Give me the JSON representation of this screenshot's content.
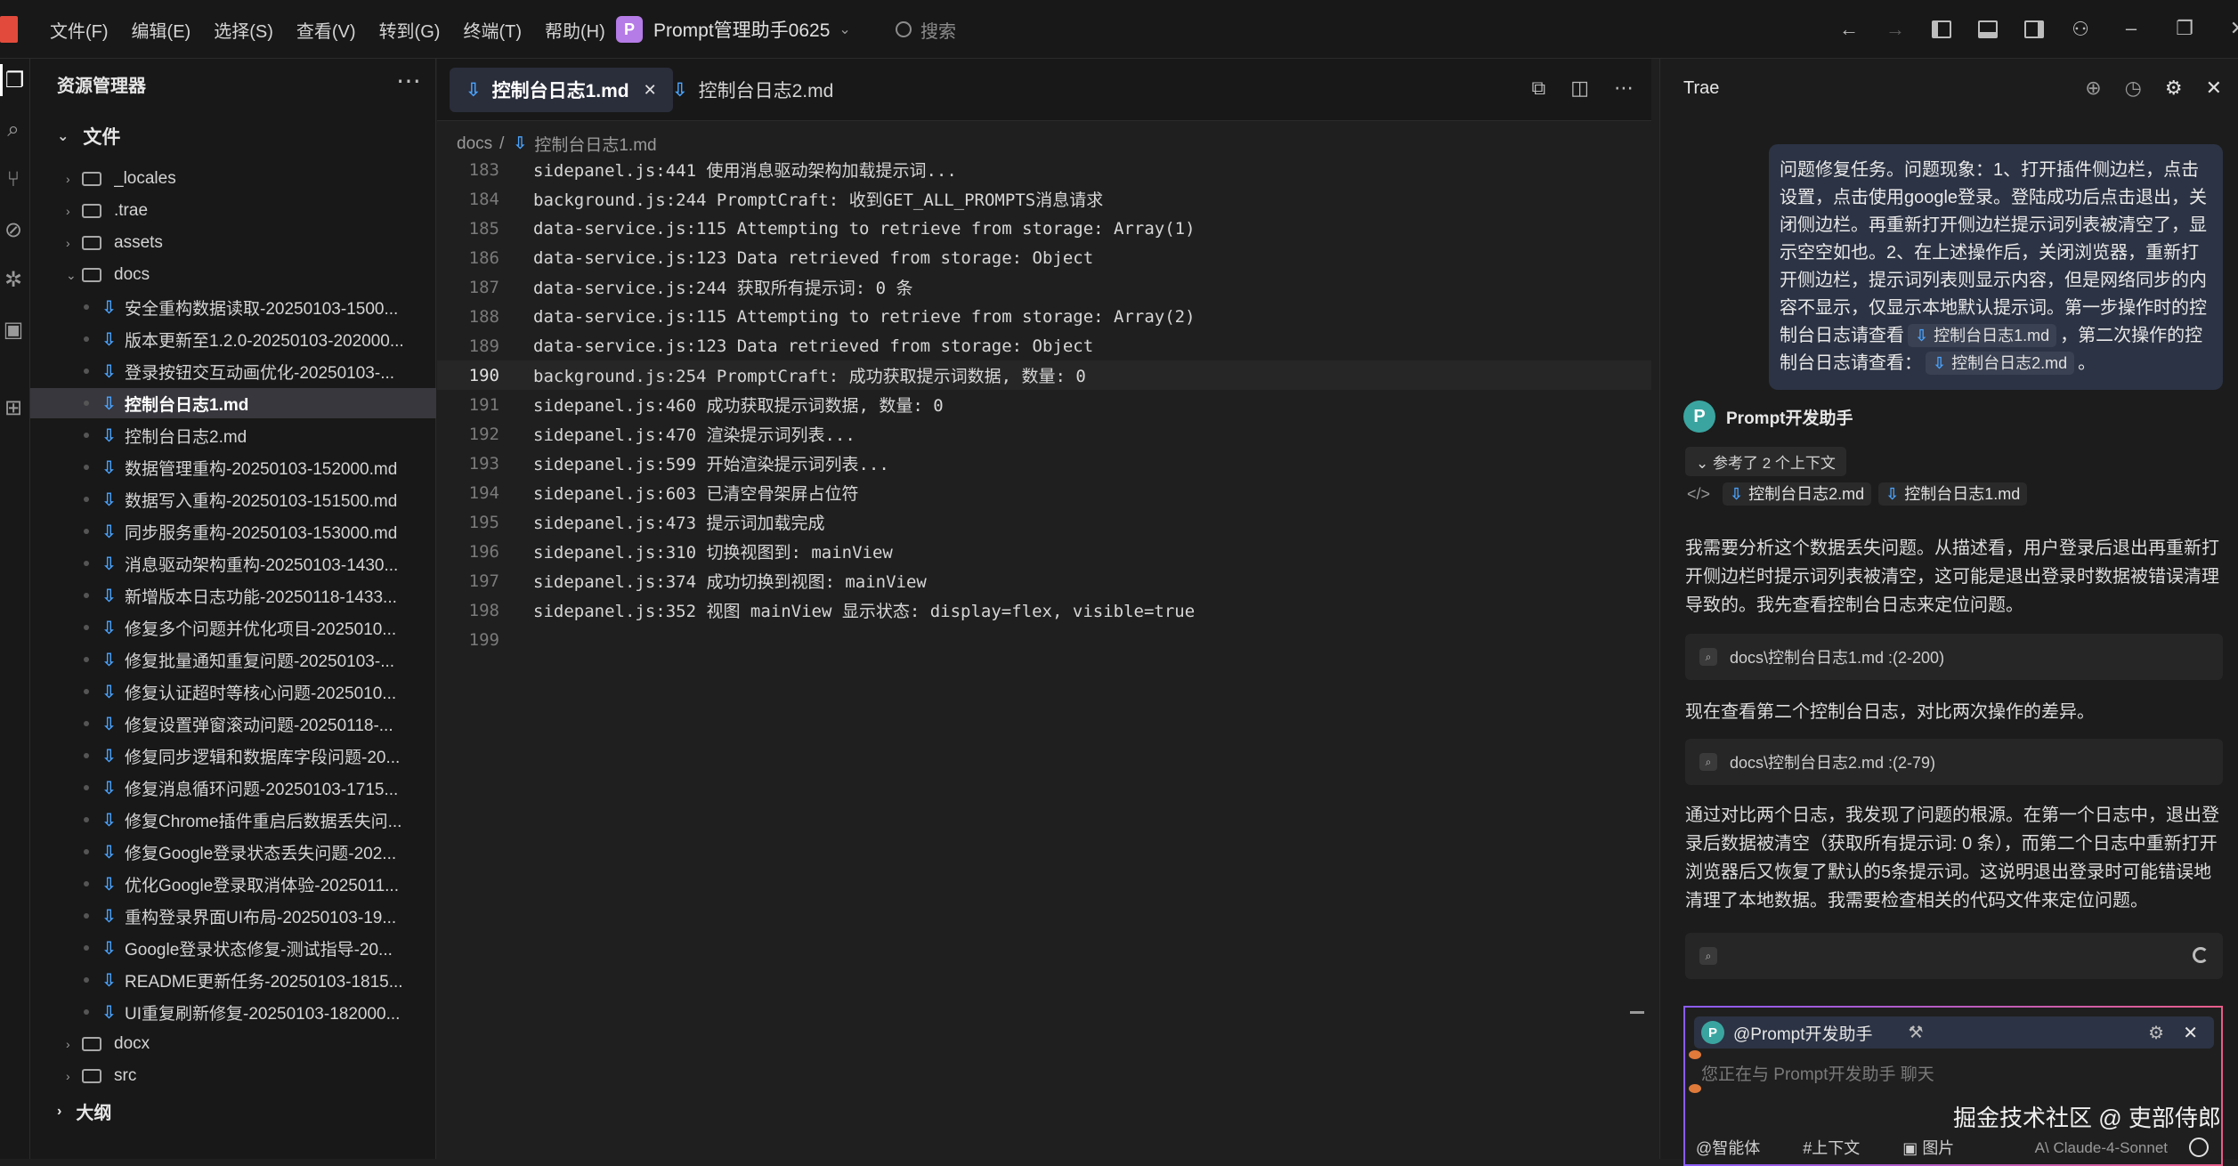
{
  "menu": [
    "文件(F)",
    "编辑(E)",
    "选择(S)",
    "查看(V)",
    "转到(G)",
    "终端(T)",
    "帮助(H)"
  ],
  "project": {
    "badge": "P",
    "name": "Prompt管理助手0625"
  },
  "search": {
    "placeholder": "搜索"
  },
  "sidebar": {
    "title": "资源管理器",
    "section": "文件",
    "items": [
      {
        "type": "folder",
        "label": "_locales",
        "expanded": false
      },
      {
        "type": "folder",
        "label": ".trae",
        "expanded": false
      },
      {
        "type": "folder",
        "label": "assets",
        "expanded": false
      },
      {
        "type": "folder",
        "label": "docs",
        "expanded": true
      },
      {
        "type": "file",
        "label": "安全重构数据读取-20250103-1500..."
      },
      {
        "type": "file",
        "label": "版本更新至1.2.0-20250103-202000..."
      },
      {
        "type": "file",
        "label": "登录按钮交互动画优化-20250103-..."
      },
      {
        "type": "file",
        "label": "控制台日志1.md",
        "active": true
      },
      {
        "type": "file",
        "label": "控制台日志2.md"
      },
      {
        "type": "file",
        "label": "数据管理重构-20250103-152000.md"
      },
      {
        "type": "file",
        "label": "数据写入重构-20250103-151500.md"
      },
      {
        "type": "file",
        "label": "同步服务重构-20250103-153000.md"
      },
      {
        "type": "file",
        "label": "消息驱动架构重构-20250103-1430..."
      },
      {
        "type": "file",
        "label": "新增版本日志功能-20250118-1433..."
      },
      {
        "type": "file",
        "label": "修复多个问题并优化项目-2025010..."
      },
      {
        "type": "file",
        "label": "修复批量通知重复问题-20250103-..."
      },
      {
        "type": "file",
        "label": "修复认证超时等核心问题-2025010..."
      },
      {
        "type": "file",
        "label": "修复设置弹窗滚动问题-20250118-..."
      },
      {
        "type": "file",
        "label": "修复同步逻辑和数据库字段问题-20..."
      },
      {
        "type": "file",
        "label": "修复消息循环问题-20250103-1715..."
      },
      {
        "type": "file",
        "label": "修复Chrome插件重启后数据丢失问..."
      },
      {
        "type": "file",
        "label": "修复Google登录状态丢失问题-202..."
      },
      {
        "type": "file",
        "label": "优化Google登录取消体验-2025011..."
      },
      {
        "type": "file",
        "label": "重构登录界面UI布局-20250103-19..."
      },
      {
        "type": "file",
        "label": "Google登录状态修复-测试指导-20..."
      },
      {
        "type": "file",
        "label": "README更新任务-20250103-1815..."
      },
      {
        "type": "file",
        "label": "UI重复刷新修复-20250103-182000..."
      },
      {
        "type": "folder",
        "label": "docx",
        "expanded": false
      },
      {
        "type": "folder",
        "label": "src",
        "expanded": false
      }
    ],
    "outline": "大纲"
  },
  "editor": {
    "tabs": [
      {
        "label": "控制台日志1.md",
        "active": true
      },
      {
        "label": "控制台日志2.md",
        "active": false
      }
    ],
    "breadcrumb": [
      "docs",
      "控制台日志1.md"
    ],
    "current_line": 190,
    "lines": [
      {
        "n": "183",
        "t": "sidepanel.js:441 使用消息驱动架构加载提示词..."
      },
      {
        "n": "184",
        "t": "background.js:244 PromptCraft: 收到GET_ALL_PROMPTS消息请求"
      },
      {
        "n": "185",
        "t": "data-service.js:115 Attempting to retrieve from storage: Array(1)"
      },
      {
        "n": "186",
        "t": "data-service.js:123 Data retrieved from storage: Object"
      },
      {
        "n": "187",
        "t": "data-service.js:244 获取所有提示词: 0 条"
      },
      {
        "n": "188",
        "t": "data-service.js:115 Attempting to retrieve from storage: Array(2)"
      },
      {
        "n": "189",
        "t": "data-service.js:123 Data retrieved from storage: Object"
      },
      {
        "n": "190",
        "t": "background.js:254 PromptCraft: 成功获取提示词数据, 数量: 0"
      },
      {
        "n": "191",
        "t": "sidepanel.js:460 成功获取提示词数据, 数量: 0"
      },
      {
        "n": "192",
        "t": "sidepanel.js:470 渲染提示词列表..."
      },
      {
        "n": "193",
        "t": "sidepanel.js:599 开始渲染提示词列表..."
      },
      {
        "n": "194",
        "t": "sidepanel.js:603 已清空骨架屏占位符"
      },
      {
        "n": "195",
        "t": "sidepanel.js:473 提示词加载完成"
      },
      {
        "n": "196",
        "t": "sidepanel.js:310 切换视图到: mainView"
      },
      {
        "n": "197",
        "t": "sidepanel.js:374 成功切换到视图: mainView"
      },
      {
        "n": "198",
        "t": "sidepanel.js:352 视图 mainView 显示状态: display=flex, visible=true"
      },
      {
        "n": "199",
        "t": ""
      }
    ]
  },
  "chat": {
    "title": "Trae",
    "user_msg_part1": "问题修复任务。问题现象：1、打开插件侧边栏，点击设置，点击使用google登录。登陆成功后点击退出，关闭侧边栏。再重新打开侧边栏提示词列表被清空了，显示空空如也。2、在上述操作后，关闭浏览器，重新打开侧边栏，提示词列表则显示内容，但是网络同步的内容不显示，仅显示本地默认提示词。第一步操作时的控制台日志请查看",
    "user_chip1": "控制台日志1.md",
    "user_msg_part2": "，第二次操作的控制台日志请查看：",
    "user_chip2": "控制台日志2.md",
    "user_msg_end": "。",
    "assistant_badge": "P",
    "assistant_name": "Prompt开发助手",
    "ref_toggle": "参考了 2 个上下文",
    "refs": [
      "控制台日志2.md",
      "控制台日志1.md"
    ],
    "para1": "我需要分析这个数据丢失问题。从描述看，用户登录后退出再重新打开侧边栏时提示词列表被清空，这可能是退出登录时数据被错误清理导致的。我先查看控制台日志来定位问题。",
    "tool1": "docs\\控制台日志1.md :(2-200)",
    "para2": "现在查看第二个控制台日志，对比两次操作的差异。",
    "tool2": "docs\\控制台日志2.md :(2-79)",
    "para3": "通过对比两个日志，我发现了问题的根源。在第一个日志中，退出登录后数据被清空（获取所有提示词: 0 条），而第二个日志中重新打开浏览器后又恢复了默认的5条提示词。这说明退出登录时可能错误地清理了本地数据。我需要检查相关的代码文件来定位问题。",
    "input": {
      "mention": "@Prompt开发助手",
      "placeholder": "您正在与 Prompt开发助手 聊天",
      "agent": "智能体",
      "context": "上下文",
      "image": "图片",
      "model": "Claude-4-Sonnet"
    }
  },
  "watermark": "掘金技术社区 @ 吏部侍郎"
}
